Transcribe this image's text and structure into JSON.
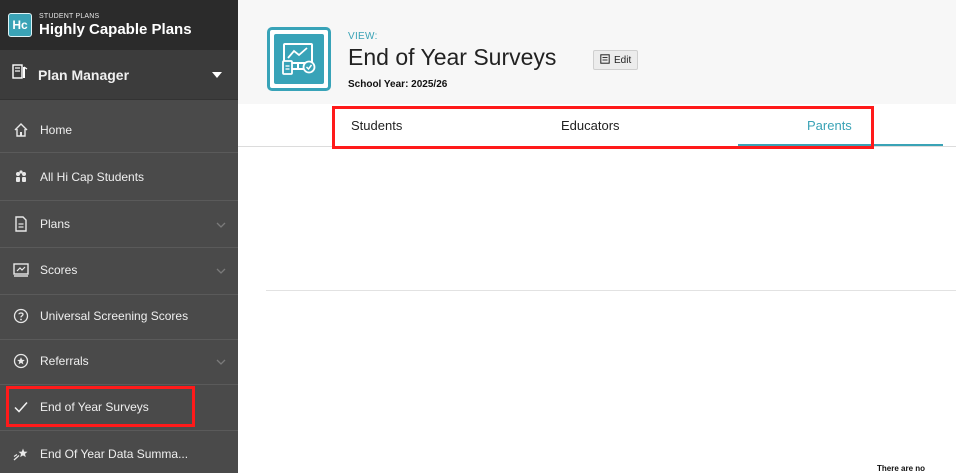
{
  "brand": {
    "logo": "Hc",
    "subtitle": "STUDENT PLANS",
    "title": "Highly Capable Plans"
  },
  "sidebar": {
    "section": "Plan Manager",
    "items": [
      {
        "label": "Home",
        "icon": "home-icon"
      },
      {
        "label": "All Hi Cap Students",
        "icon": "students-group-icon"
      },
      {
        "label": "Plans",
        "icon": "document-icon",
        "expandable": true
      },
      {
        "label": "Scores",
        "icon": "scores-icon",
        "expandable": true
      },
      {
        "label": "Universal Screening Scores",
        "icon": "question-circle-icon"
      },
      {
        "label": "Referrals",
        "icon": "star-circle-icon",
        "expandable": true
      },
      {
        "label": "End of Year Surveys",
        "icon": "checkmark-icon",
        "selected": true
      },
      {
        "label": "End Of Year Data Summa...",
        "icon": "shooting-star-icon"
      }
    ]
  },
  "header": {
    "view_label": "VIEW:",
    "title": "End of Year Surveys",
    "edit_label": "Edit",
    "school_year": "School Year: 2025/26"
  },
  "tabs": [
    {
      "label": "Students",
      "active": false
    },
    {
      "label": "Educators",
      "active": false
    },
    {
      "label": "Parents",
      "active": true
    }
  ],
  "content": {
    "empty_message": "There are no"
  },
  "colors": {
    "accent": "#3aa3b6",
    "sidebar": "#4a4a4a",
    "highlight": "#ff1a1a"
  }
}
